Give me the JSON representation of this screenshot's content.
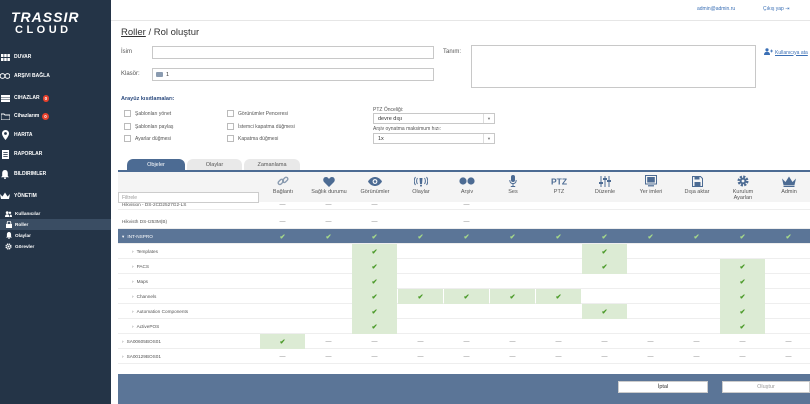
{
  "sidebar": {
    "logo_line1": "TRASSIR",
    "logo_line2": "CLOUD",
    "items": [
      {
        "label": "DUVAR"
      },
      {
        "label": "ARŞIVI BAĞLA"
      },
      {
        "label": "CIHAZLAR",
        "badge": "0"
      },
      {
        "label": "Cihazlarım",
        "badge": "0"
      },
      {
        "label": "HARITA"
      },
      {
        "label": "RAPORLAR"
      },
      {
        "label": "BILDIRIMLER"
      },
      {
        "label": "YÖNETIM"
      }
    ],
    "sub_items": [
      {
        "label": "Kullanıcılar"
      },
      {
        "label": "Roller"
      },
      {
        "label": "Olaylar"
      },
      {
        "label": "Görevler"
      }
    ]
  },
  "topbar": {
    "user": "admin@admin.ru",
    "logout": "Çıkış yap"
  },
  "breadcrumb": {
    "parent": "Roller",
    "sep": "/",
    "current": "Rol oluştur"
  },
  "form": {
    "name_label": "İsim",
    "name_value": "",
    "folder_label": "Klasör:",
    "folder_value": "1",
    "desc_label": "Tanım:",
    "add_users_link": "Kullanıcıya ata"
  },
  "restrictions": {
    "title": "Arayüz kısıtlamaları:",
    "col1": [
      "Şablonları yönet",
      "Şablonları paylaş",
      "Ayarlar düğmesi"
    ],
    "col2": [
      "Görünümler Penceresi",
      "İstemci kapatma düğmesi",
      "Kapatma düğmesi"
    ],
    "ptz_label": "PTZ Önceliği:",
    "ptz_value": "devre dışı",
    "speed_label": "Arşiv oynatma maksimum hızı:",
    "speed_value": "1x"
  },
  "tabs": [
    "Objeler",
    "Olaylar",
    "Zamanlama"
  ],
  "filter_placeholder": "Filtrele",
  "columns": [
    {
      "label": "Bağlantı",
      "icon": "link-icon"
    },
    {
      "label": "Sağlık durumu",
      "icon": "heart-icon"
    },
    {
      "label": "Görünümler",
      "icon": "eye-icon"
    },
    {
      "label": "Olaylar",
      "icon": "signal-icon"
    },
    {
      "label": "Arşiv",
      "icon": "reel-icon"
    },
    {
      "label": "Ses",
      "icon": "microphone-icon"
    },
    {
      "label": "PTZ",
      "icon": "ptz-icon"
    },
    {
      "label": "Düzenle",
      "icon": "sliders-icon"
    },
    {
      "label": "Yer imleri",
      "icon": "bookmark-icon"
    },
    {
      "label": "Dışa aktar",
      "icon": "save-icon"
    },
    {
      "label": "Kurulum Ayarları",
      "icon": "gear-icon"
    },
    {
      "label": "Admin",
      "icon": "crown-icon"
    }
  ],
  "marks": {
    "check": "✔",
    "dash": "—"
  },
  "rows": [
    {
      "name": "Hikvision - DS-2CD2527G2-LS",
      "level": 0,
      "expander": "",
      "vals": [
        "-",
        "-",
        "-",
        "",
        "-",
        "",
        "",
        "",
        "",
        "",
        "",
        ""
      ]
    },
    {
      "name": "Hikvisth DS-I253M(B)",
      "level": 0,
      "expander": "",
      "vals": [
        "-",
        "-",
        "-",
        "",
        "-",
        "",
        "",
        "",
        "",
        "",
        "",
        ""
      ]
    },
    {
      "name": "INT-NSPRO",
      "level": 0,
      "expander": "▾",
      "selected": true,
      "vals": [
        "c",
        "c",
        "c",
        "c",
        "c",
        "c",
        "c",
        "c",
        "c",
        "c",
        "c",
        "c"
      ]
    },
    {
      "name": "Templates",
      "level": 1,
      "expander": "›",
      "vals": [
        "",
        "",
        "c",
        "",
        "",
        "",
        "",
        "c",
        "",
        "",
        "",
        ""
      ]
    },
    {
      "name": "PACS",
      "level": 1,
      "expander": "›",
      "vals": [
        "",
        "",
        "c",
        "",
        "",
        "",
        "",
        "c",
        "",
        "",
        "c",
        ""
      ]
    },
    {
      "name": "Maps",
      "level": 1,
      "expander": "›",
      "vals": [
        "",
        "",
        "c",
        "",
        "",
        "",
        "",
        "",
        "",
        "",
        "c",
        ""
      ]
    },
    {
      "name": "Channels",
      "level": 1,
      "expander": "›",
      "vals": [
        "",
        "",
        "c",
        "c",
        "c",
        "c",
        "c",
        "",
        "",
        "",
        "c",
        ""
      ]
    },
    {
      "name": "Automation Components",
      "level": 1,
      "expander": "›",
      "vals": [
        "",
        "",
        "c",
        "",
        "",
        "",
        "",
        "c",
        "",
        "",
        "c",
        ""
      ]
    },
    {
      "name": "ActivePOS",
      "level": 1,
      "expander": "›",
      "vals": [
        "",
        "",
        "c",
        "",
        "",
        "",
        "",
        "",
        "",
        "",
        "c",
        ""
      ]
    },
    {
      "name": "SA00605BOS01",
      "level": 0,
      "expander": "›",
      "vals": [
        "c",
        "-",
        "-",
        "-",
        "-",
        "-",
        "-",
        "-",
        "-",
        "-",
        "-",
        "-"
      ]
    },
    {
      "name": "SA00129BOS01",
      "level": 0,
      "expander": "›",
      "vals": [
        "-",
        "-",
        "-",
        "-",
        "-",
        "-",
        "-",
        "-",
        "-",
        "-",
        "-",
        "-"
      ]
    }
  ],
  "footer": {
    "cancel": "İptal",
    "create": "Oluştur"
  }
}
